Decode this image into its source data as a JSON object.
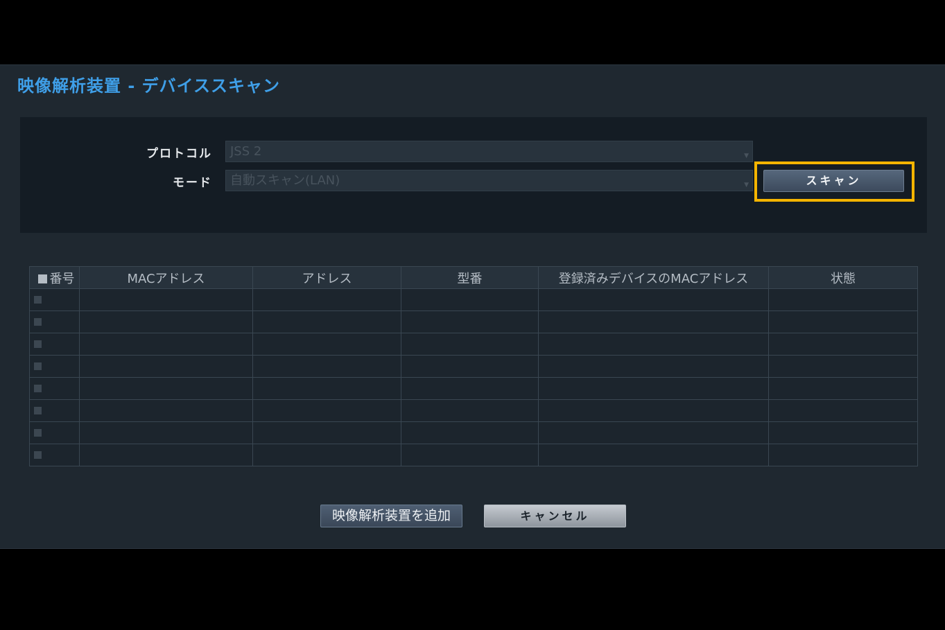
{
  "dialog": {
    "title": "映像解析装置 - デバイススキャン"
  },
  "settings": {
    "protocol_label": "プロトコル",
    "protocol_value": "JSS 2",
    "mode_label": "モード",
    "mode_value": "自動スキャン(LAN)",
    "scan_button": "スキャン"
  },
  "table": {
    "columns": [
      "番号",
      "MACアドレス",
      "アドレス",
      "型番",
      "登録済みデバイスのMACアドレス",
      "状態"
    ],
    "row_count": 8
  },
  "footer": {
    "add_button": "映像解析装置を追加",
    "cancel_button": "キャンセル"
  },
  "colors": {
    "title": "#3f9fe8",
    "highlight": "#f4b400",
    "dialog_bg": "#1f2830",
    "panel_bg": "#141c24"
  }
}
